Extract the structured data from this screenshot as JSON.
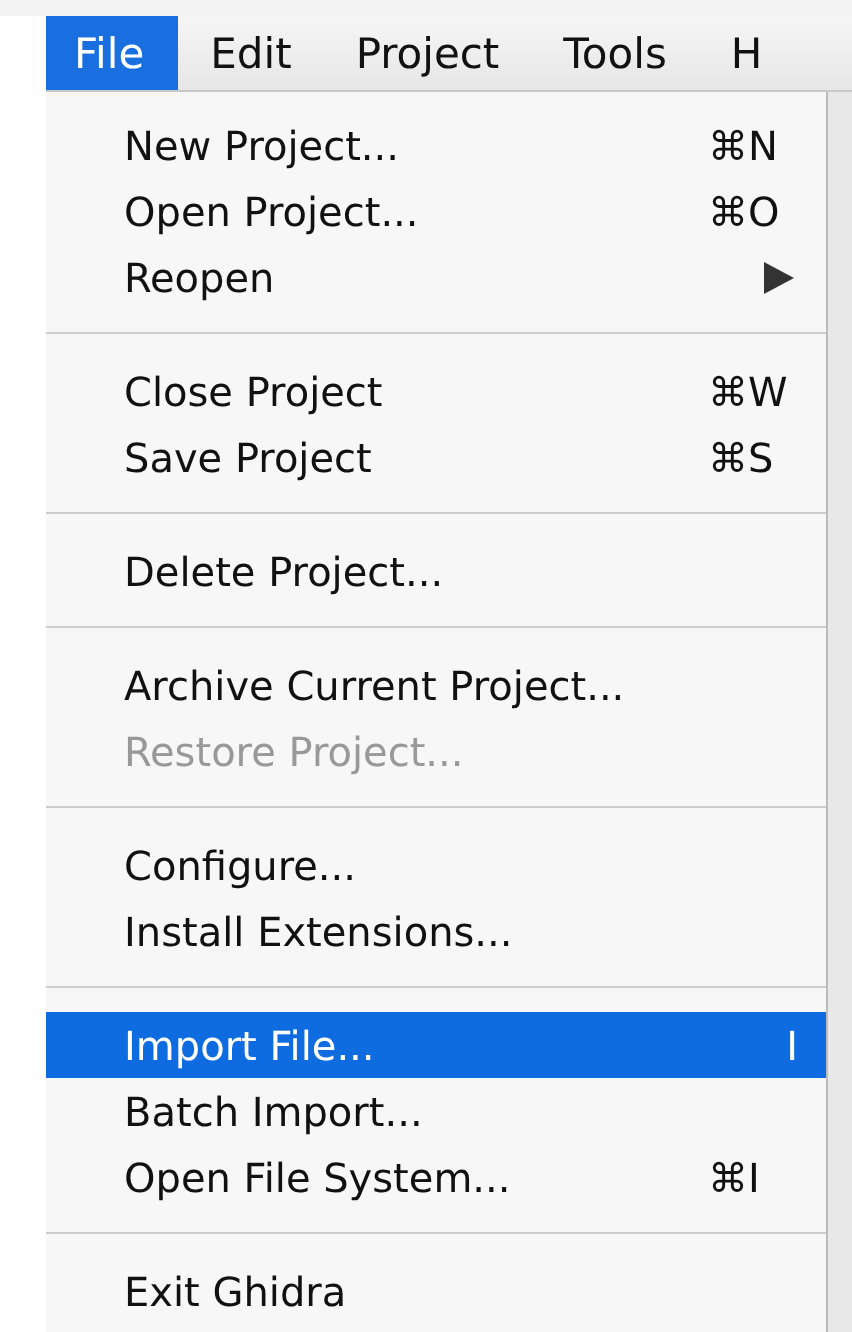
{
  "menu_bar": [
    {
      "label": "File",
      "selected": true
    },
    {
      "label": "Edit",
      "selected": false
    },
    {
      "label": "Project",
      "selected": false
    },
    {
      "label": "Tools",
      "selected": false
    },
    {
      "label": "H",
      "selected": false
    }
  ],
  "file_menu": [
    {
      "kind": "item",
      "label": "New Project...",
      "shortcut": "⌘N",
      "disabled": false,
      "selected": false
    },
    {
      "kind": "item",
      "label": "Open Project...",
      "shortcut": "⌘O",
      "disabled": false,
      "selected": false
    },
    {
      "kind": "submenu",
      "label": "Reopen",
      "disabled": false,
      "selected": false
    },
    {
      "kind": "separator"
    },
    {
      "kind": "item",
      "label": "Close Project",
      "shortcut": "⌘W",
      "disabled": false,
      "selected": false
    },
    {
      "kind": "item",
      "label": "Save Project",
      "shortcut": "⌘S",
      "disabled": false,
      "selected": false
    },
    {
      "kind": "separator"
    },
    {
      "kind": "item",
      "label": "Delete Project...",
      "disabled": false,
      "selected": false
    },
    {
      "kind": "separator"
    },
    {
      "kind": "item",
      "label": "Archive Current Project...",
      "disabled": false,
      "selected": false
    },
    {
      "kind": "item",
      "label": "Restore Project...",
      "disabled": true,
      "selected": false
    },
    {
      "kind": "separator"
    },
    {
      "kind": "item",
      "label": "Configure...",
      "disabled": false,
      "selected": false
    },
    {
      "kind": "item",
      "label": "Install Extensions...",
      "disabled": false,
      "selected": false
    },
    {
      "kind": "separator"
    },
    {
      "kind": "item",
      "label": "Import File...",
      "shortcut": "I",
      "disabled": false,
      "selected": true
    },
    {
      "kind": "item",
      "label": "Batch Import...",
      "disabled": false,
      "selected": false
    },
    {
      "kind": "item",
      "label": "Open File System...",
      "shortcut": "⌘I",
      "disabled": false,
      "selected": false
    },
    {
      "kind": "separator"
    },
    {
      "kind": "item",
      "label": "Exit Ghidra",
      "disabled": false,
      "selected": false
    }
  ]
}
